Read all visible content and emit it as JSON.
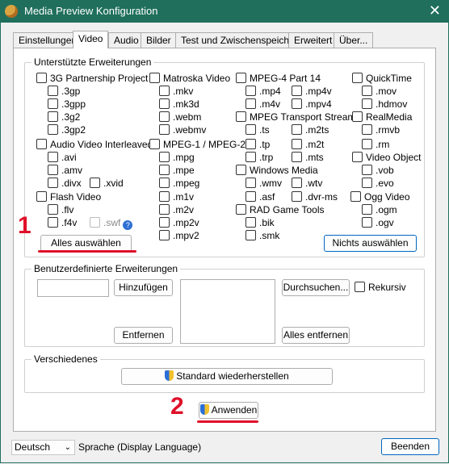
{
  "window": {
    "title": "Media Preview Konfiguration",
    "close_glyph": "✕"
  },
  "tabs": [
    "Einstellungen",
    "Video",
    "Audio",
    "Bilder",
    "Test und Zwischenspeicher",
    "Erweitert",
    "Über..."
  ],
  "supported": {
    "title": "Unterstützte Erweiterungen",
    "groups": {
      "gp3": "3G Partnership Project",
      "gp3_items": [
        ".3gp",
        ".3gpp",
        ".3g2",
        ".3gp2"
      ],
      "avi": "Audio Video Interleaved",
      "avi_items": [
        ".avi",
        ".amv",
        ".divx",
        ".xvid"
      ],
      "flash": "Flash Video",
      "flash_items": [
        ".flv",
        ".f4v",
        ".swf"
      ],
      "mkv": "Matroska Video",
      "mkv_items": [
        ".mkv",
        ".mk3d",
        ".webm",
        ".webmv"
      ],
      "mpeg12": "MPEG-1 / MPEG-2",
      "mpeg12_items": [
        ".mpg",
        ".mpe",
        ".mpeg",
        ".m1v",
        ".m2v",
        ".mp2v",
        ".mpv2"
      ],
      "mp4": "MPEG-4 Part 14",
      "mp4_items": [
        ".mp4",
        ".mp4v",
        ".m4v",
        ".mpv4"
      ],
      "ts": "MPEG Transport Stream",
      "ts_items": [
        ".ts",
        ".m2ts",
        ".tp",
        ".m2t",
        ".trp",
        ".mts"
      ],
      "wm": "Windows Media",
      "wm_items": [
        ".wmv",
        ".wtv",
        ".asf",
        ".dvr-ms"
      ],
      "rad": "RAD Game Tools",
      "rad_items": [
        ".bik",
        ".smk"
      ],
      "qt": "QuickTime",
      "qt_items": [
        ".mov",
        ".hdmov"
      ],
      "rm": "RealMedia",
      "rm_items": [
        ".rmvb",
        ".rm"
      ],
      "vo": "Video Object",
      "vo_items": [
        ".vob",
        ".evo"
      ],
      "ogg": "Ogg Video",
      "ogg_items": [
        ".ogm",
        ".ogv"
      ]
    },
    "help_glyph": "?",
    "select_all": "Alles auswählen",
    "select_none": "Nichts auswählen"
  },
  "custom": {
    "title": "Benutzerdefinierte Erweiterungen",
    "add": "Hinzufügen",
    "remove": "Entfernen",
    "browse": "Durchsuchen...",
    "recursive": "Rekursiv",
    "remove_all": "Alles entfernen"
  },
  "misc": {
    "title": "Verschiedenes",
    "restore": "Standard wiederherstellen"
  },
  "apply": "Anwenden",
  "annotations": {
    "one": "1",
    "two": "2"
  },
  "footer": {
    "language_value": "Deutsch",
    "language_label": "Sprache (Display Language)",
    "close": "Beenden"
  },
  "colors": {
    "titlebar": "#1f6f5c",
    "annotation": "#e0102a",
    "accent": "#0067c0"
  }
}
